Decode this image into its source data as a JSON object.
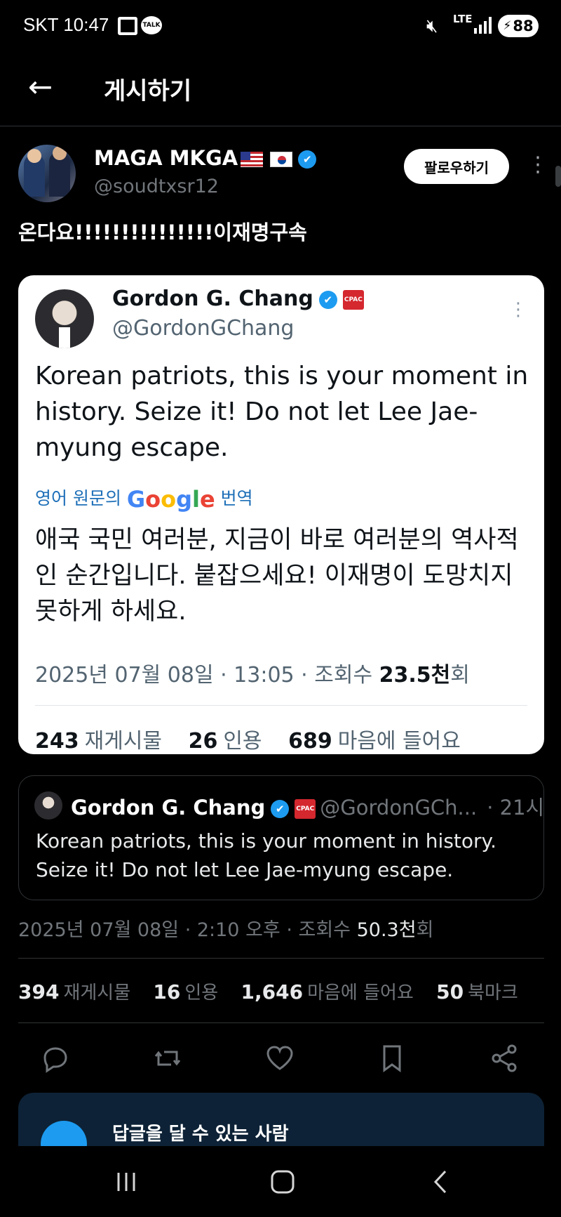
{
  "status_bar": {
    "carrier_time": "SKT 10:47",
    "chat_badge": "TALK",
    "network": "LTE",
    "battery": "88",
    "icons": [
      "caption-icon",
      "talk-icon",
      "mute-icon",
      "signal-icon",
      "battery-charging-icon"
    ]
  },
  "header": {
    "back_icon": "←",
    "title": "게시하기"
  },
  "post": {
    "author_name": "MAGA MKGA",
    "author_handle": "@soudtxsr12",
    "follow_label": "팔로우하기",
    "text": "온다요!!!!!!!!!!!!!!!이재명구속",
    "meta_date": "2025년 07월 08일 · 2:10 오후 · 조회수 ",
    "meta_views": "50.3천",
    "meta_suffix": "회",
    "stats": {
      "reposts": "394",
      "reposts_label": "재게시물",
      "quotes": "16",
      "quotes_label": "인용",
      "likes": "1,646",
      "likes_label": "마음에 들어요",
      "bookmarks": "50",
      "bookmarks_label": "북마크"
    }
  },
  "embedded_screenshot": {
    "name": "Gordon G. Chang",
    "badge": "CPAC",
    "handle": "@GordonGChang",
    "text": "Korean patriots, this is your moment in history. Seize it! Do not let Lee Jae-myung escape.",
    "translate_prefix": "영어 원문의",
    "translate_brand": "Google",
    "translate_suffix": "번역",
    "translation": "애국 국민 여러분, 지금이 바로 여러분의 역사적인 순간입니다. 붙잡으세요! 이재명이 도망치지 못하게 하세요.",
    "meta_date": "2025년 07월 08일 · 13:05 · 조회수 ",
    "meta_views": "23.5천",
    "meta_suffix": "회",
    "stats": {
      "reposts": "243",
      "reposts_label": "재게시물",
      "quotes": "26",
      "quotes_label": "인용",
      "likes": "689",
      "likes_label": "마음에 들어요"
    }
  },
  "quoted_tweet": {
    "name": "Gordon G. Chang",
    "badge": "CPAC",
    "handle": "@GordonGCh...",
    "time": "· 21시",
    "text": "Korean patriots, this is your moment in history. Seize it! Do not let Lee Jae-myung escape."
  },
  "actions": [
    "reply-icon",
    "repost-icon",
    "like-icon",
    "bookmark-icon",
    "share-icon"
  ],
  "reply_banner": {
    "text": "답글을 달 수 있는 사람"
  },
  "colors": {
    "background": "#000000",
    "accent": "#1d9bf0",
    "muted": "#71767b",
    "divider": "#2f3336"
  }
}
